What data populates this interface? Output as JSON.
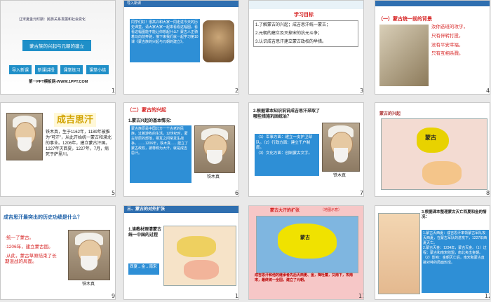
{
  "slides": [
    {
      "num": "1",
      "subtitle": "辽宋夏金元时期：民族关系发展和社会变化",
      "title": "蒙古族的兴起与元朝的建立",
      "buttons": [
        "导入新课",
        "新课讲授",
        "课堂练习",
        "课堂小结"
      ],
      "footer": "第一PPT模板网-WWW.1PPT.COM"
    },
    {
      "num": "2",
      "label": "导入新课",
      "text": "同学们好！很高兴和大家一同走进今天的历史课堂。请大家大家一起来看看这幅图，看看这幅图能不能让你想起什么？蒙古人正骑着马向前奔驰，接下来我们就一起学习第10课《蒙古族的兴起与元朝的建立》。"
    },
    {
      "num": "3",
      "title": "学习目标",
      "goals": [
        "1.了解蒙古的兴起；成吉思汗统一蒙古；",
        "2.元朝的建立及灭掉宋的抗元斗争；",
        "3.认识成吉思汗建立蒙古政权的举措。"
      ]
    },
    {
      "num": "4",
      "label": "新课讲授",
      "section": "一",
      "heading": "（一）蒙古统一前的背景",
      "poem": [
        "汝你迭班的攻乎，",
        "只有伴转打投，",
        "没有平安幸福，",
        "只有互相杀戮。"
      ]
    },
    {
      "num": "5",
      "title": "成吉思汗",
      "text": "铁木真，生于1162年，1189年被推为“可汗”，从此开始统一蒙古和漠北的事业。1206年，建立蒙古汗国。1227年灭西夏，1227年，7月，病死于萨里川。",
      "highlights": [
        "统一蒙古",
        "蒙古汗国"
      ]
    },
    {
      "num": "6",
      "heading": "（二）蒙古的兴起",
      "sub": "1.蒙古兴起的基本情况：",
      "text": "蒙古族原是中国北方一个古老的民族，过着游牧的生活。12世纪时，蒙古草原的部落，相互之间常发生战争。……1206年，铁木真……建立了蒙古政权，被尊称为大汗，就是成吉思汗。",
      "caption": "铁木真"
    },
    {
      "num": "7",
      "question": "2.根据课本知识说说成吉思汗采取了哪些措施巩固统治？",
      "answers": [
        "（1）军事方面：建立一支护卫部队。（2）行政方面：建立千户制度。",
        "（3）文化方面：创制蒙古文字。"
      ],
      "caption": "铁木真"
    },
    {
      "num": "8",
      "title": "蒙古的兴起",
      "maplabel": "蒙古"
    },
    {
      "num": "9",
      "question": "成吉思汗最突出的历史功绩是什么？",
      "points": [
        "·统一了蒙古。",
        "·1206年，建立蒙古国。",
        "·从此，蒙古草原结束了长期混战的局面。"
      ],
      "caption": "铁木真"
    },
    {
      "num": "10",
      "heading": "三、蒙古的对外扩张",
      "sub": "1.读教材理清蒙古统一中国的过程",
      "box": "西夏→金→南宋"
    },
    {
      "num": "11",
      "title": "蒙古大汗的扩张",
      "subtitle": "（地图示意）",
      "maplabel": "蒙古",
      "caption": "成吉思汗和他的继承者先后灭西夏、金，降吐蕃，又南下，攻南宋，最终统一全国，建立了元朝。"
    },
    {
      "num": "12",
      "question": "3.根据课本整理蒙古灭亡西夏和金的情况：",
      "points": [
        "1.蒙古灭西夏：成吉思汗率领蒙古军队攻灭西夏，在蒙古军队的进攻下，1227年西夏灭亡。",
        "2.蒙古灭金：1234年，蒙古灭金。（1）过程：蒙古和南宋结盟，南北夹击金朝。（2）影响：金朝灭亡后，南宋和蒙古直接对峙的局面形成。"
      ]
    }
  ],
  "colors": {
    "accent": "#1f8fc8",
    "red": "#d62222",
    "bluebox": "#2e8fd6",
    "headerbar": "#2f6fb0"
  }
}
